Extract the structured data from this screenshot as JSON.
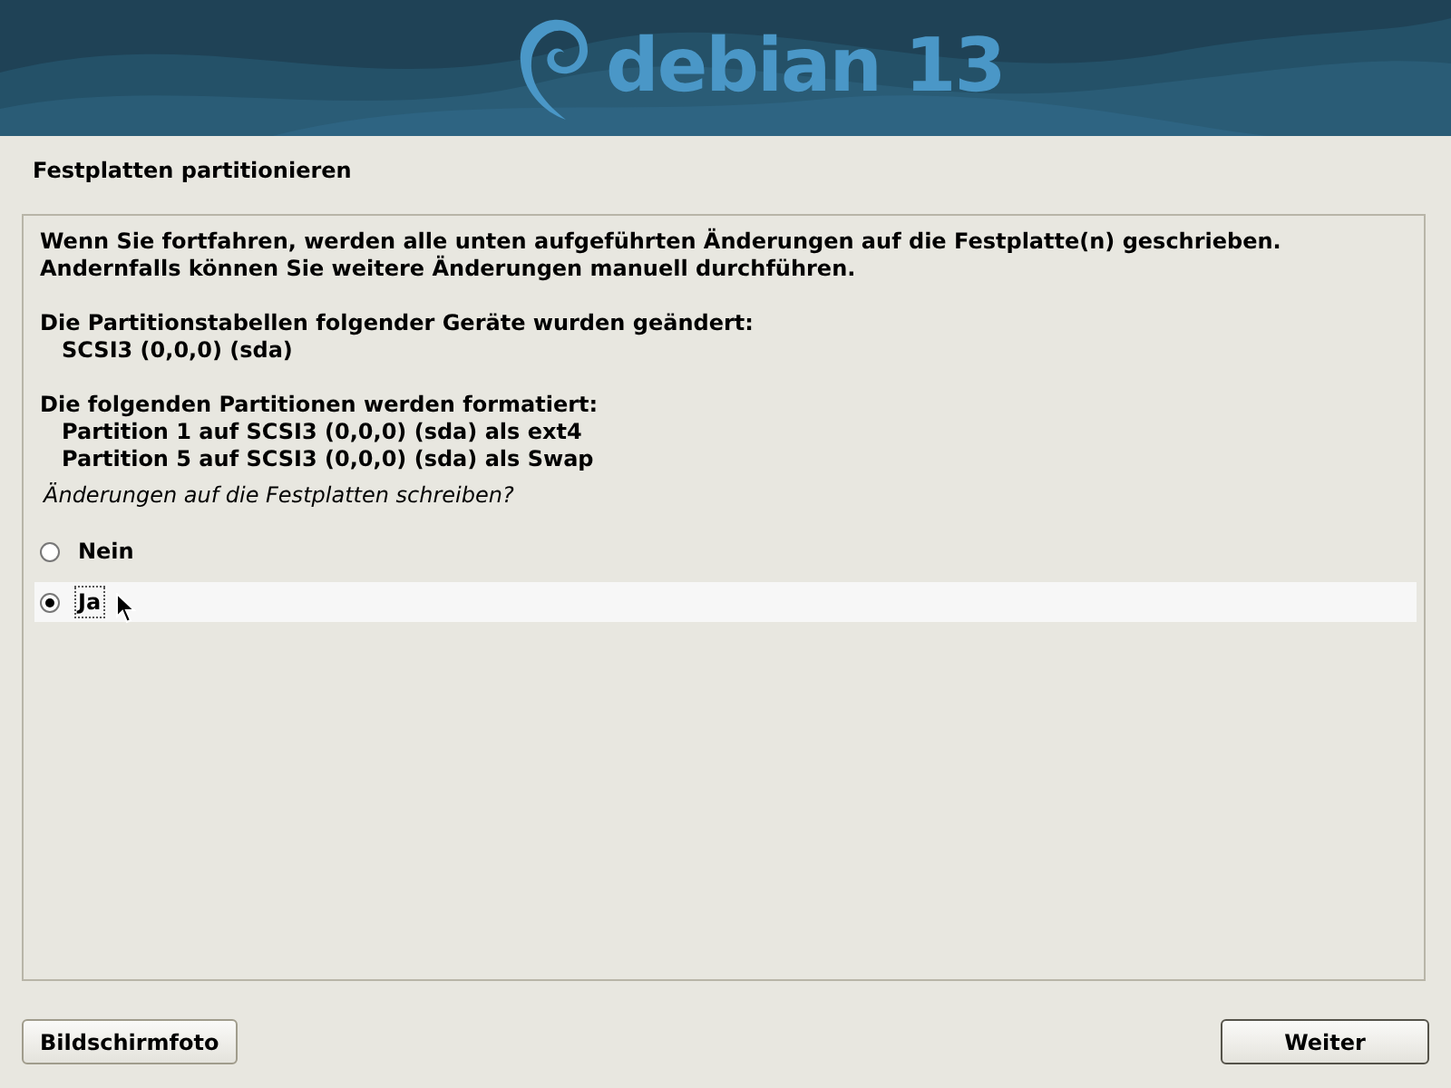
{
  "banner": {
    "logo_text": "debian 13"
  },
  "title": "Festplatten partitionieren",
  "message": {
    "intro": [
      "Wenn Sie fortfahren, werden alle unten aufgeführten Änderungen auf die Festplatte(n) geschrieben.",
      "Andernfalls können Sie weitere Änderungen manuell durchführen."
    ],
    "sections": [
      {
        "heading": "Die Partitionstabellen folgender Geräte wurden geändert:",
        "items": [
          "SCSI3 (0,0,0) (sda)"
        ]
      },
      {
        "heading": "Die folgenden Partitionen werden formatiert:",
        "items": [
          "Partition 1 auf SCSI3 (0,0,0) (sda) als ext4",
          "Partition 5 auf SCSI3 (0,0,0) (sda) als Swap"
        ]
      }
    ]
  },
  "question": "Änderungen auf die Festplatten schreiben?",
  "options": [
    {
      "label": "Nein",
      "selected": false
    },
    {
      "label": "Ja",
      "selected": true
    }
  ],
  "buttons": {
    "left": "Bildschirmfoto",
    "right": "Weiter"
  }
}
